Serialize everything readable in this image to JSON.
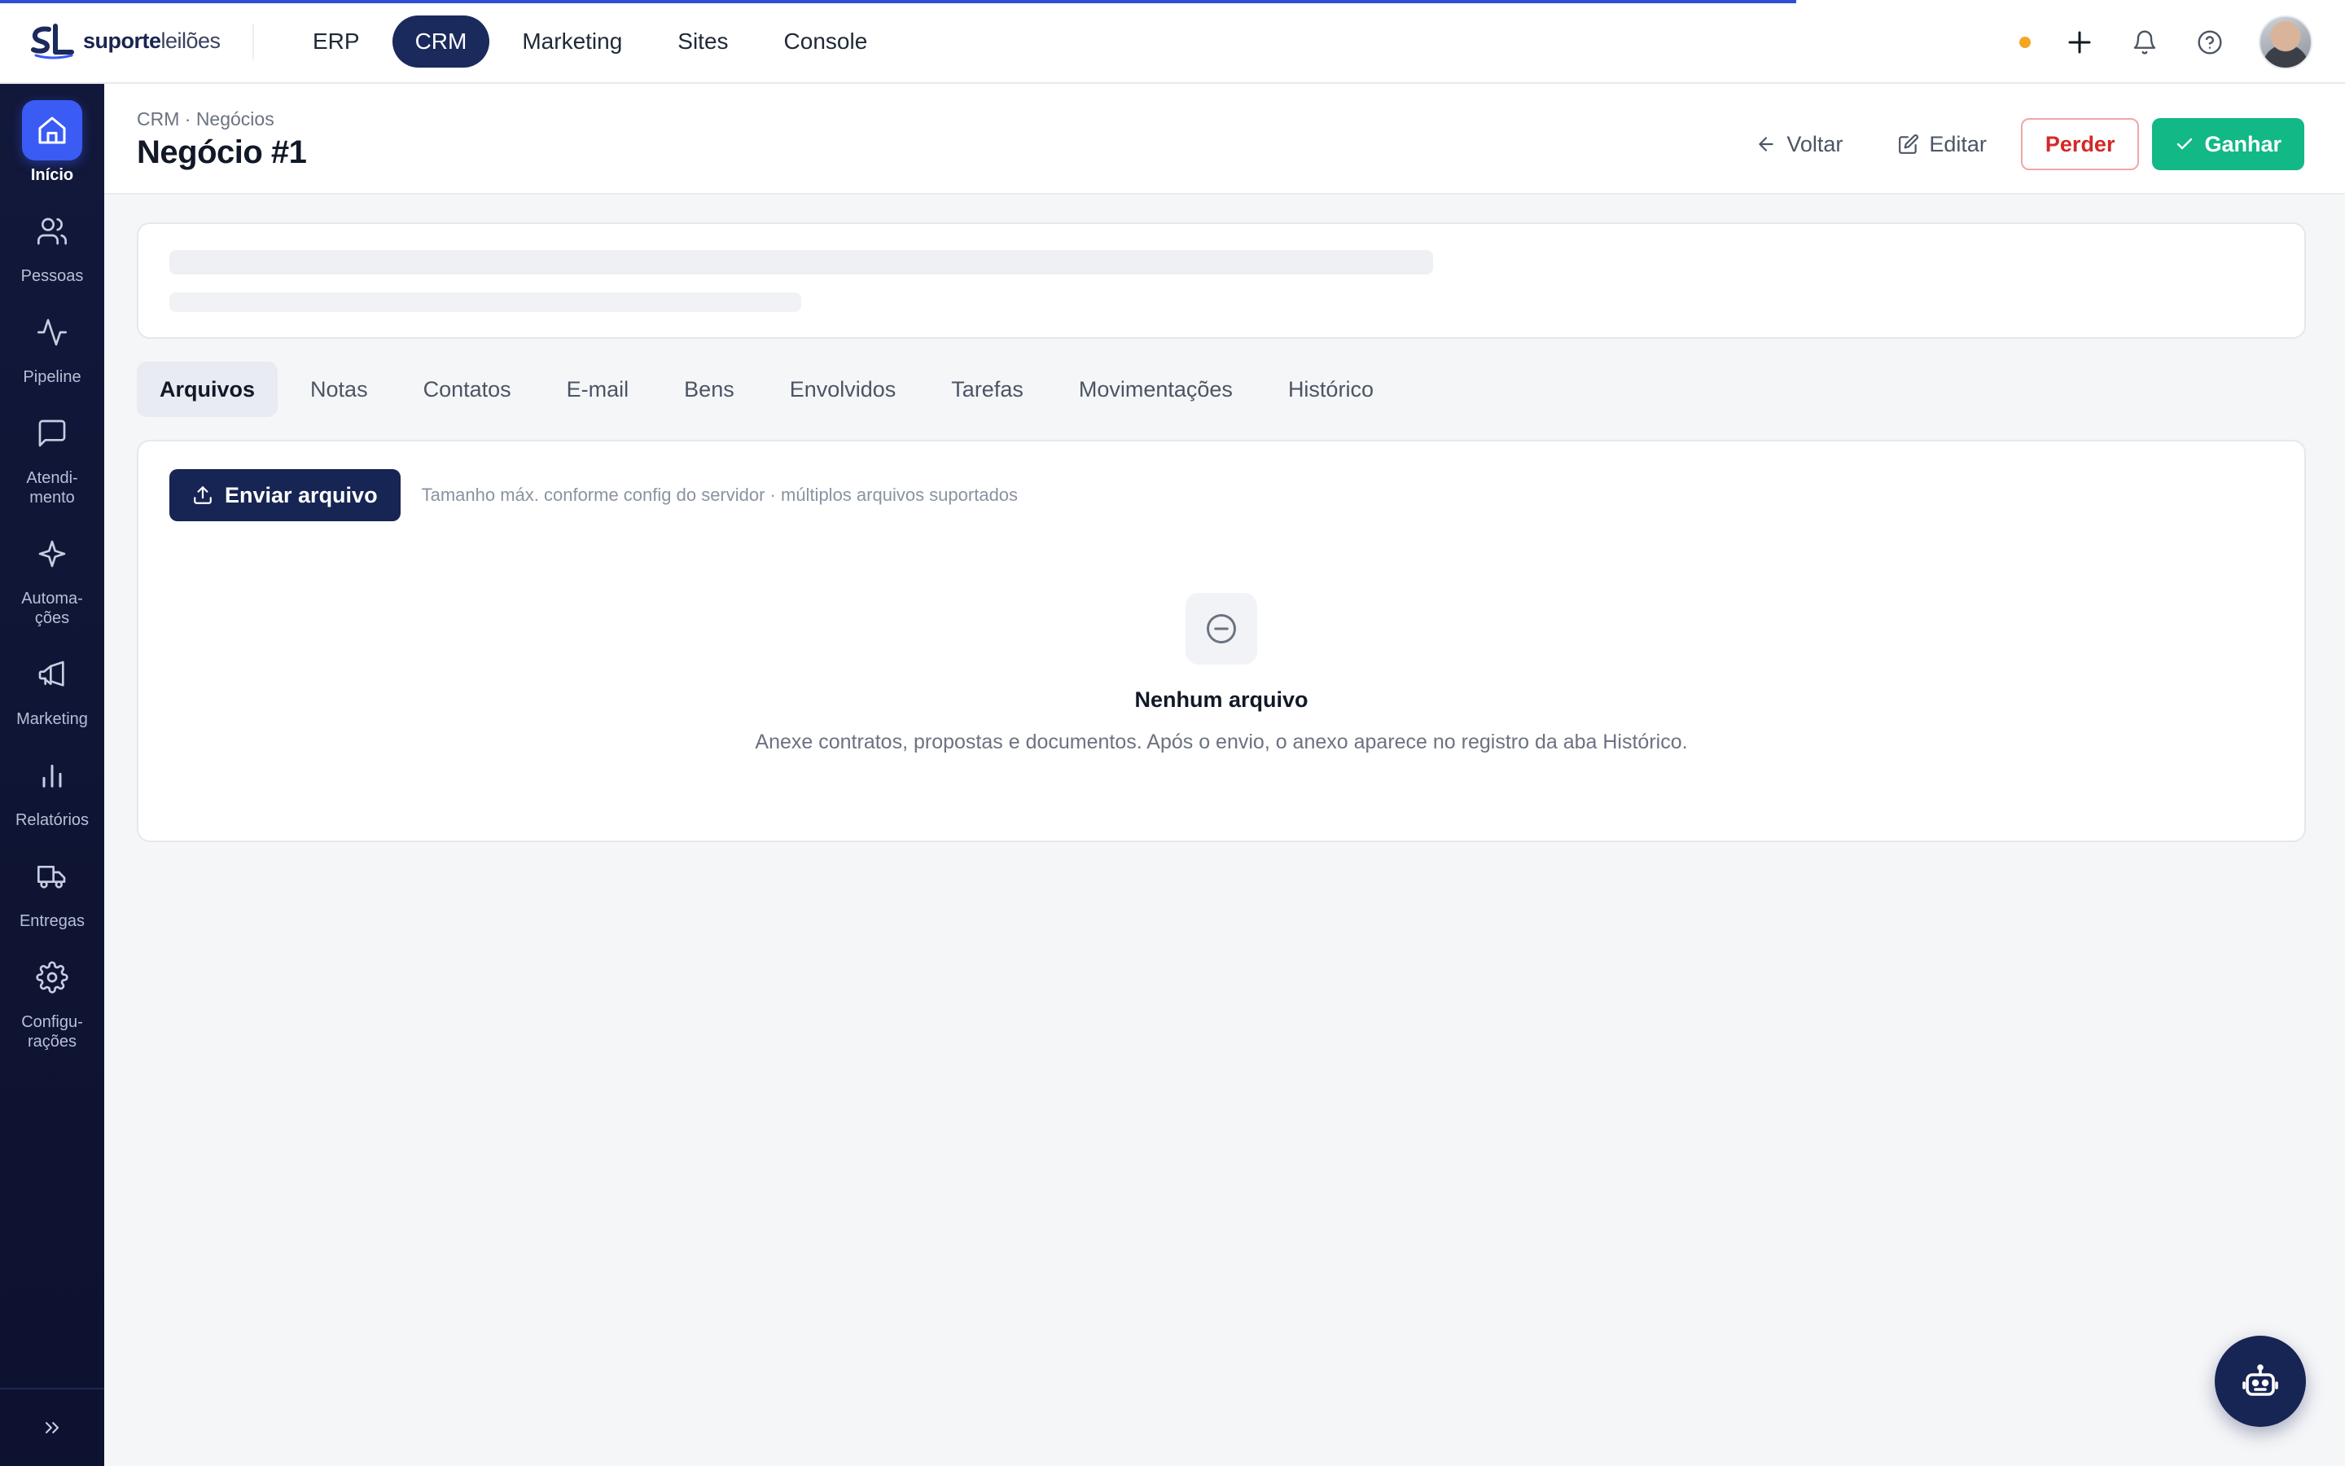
{
  "brand": {
    "bold": "suporte",
    "light": "leilões",
    "logo_icon": "sl-logo-icon"
  },
  "topnav": {
    "items": [
      {
        "label": "ERP",
        "active": false
      },
      {
        "label": "CRM",
        "active": true
      },
      {
        "label": "Marketing",
        "active": false
      },
      {
        "label": "Sites",
        "active": false
      },
      {
        "label": "Console",
        "active": false
      }
    ]
  },
  "top_actions": {
    "status_color": "#f5a524",
    "icons": [
      "plus-icon",
      "bell-icon",
      "help-icon"
    ]
  },
  "sidebar": {
    "items": [
      {
        "label": "Início",
        "icon": "home-icon",
        "active": true
      },
      {
        "label": "Pessoas",
        "icon": "users-icon",
        "active": false
      },
      {
        "label": "Pipeline",
        "icon": "activity-icon",
        "active": false
      },
      {
        "label": "Atendi-\nmento",
        "icon": "chat-icon",
        "active": false
      },
      {
        "label": "Automa-\nções",
        "icon": "sparkle-icon",
        "active": false
      },
      {
        "label": "Marketing",
        "icon": "megaphone-icon",
        "active": false
      },
      {
        "label": "Relatórios",
        "icon": "bar-chart-icon",
        "active": false
      },
      {
        "label": "Entregas",
        "icon": "truck-icon",
        "active": false
      },
      {
        "label": "Configu-\nrações",
        "icon": "gear-icon",
        "active": false
      }
    ]
  },
  "page": {
    "breadcrumb": "CRM · Negócios",
    "title": "Negócio #1",
    "actions": {
      "back": "Voltar",
      "edit": "Editar",
      "lose": "Perder",
      "win": "Ganhar"
    }
  },
  "tabs": [
    {
      "label": "Arquivos",
      "active": true
    },
    {
      "label": "Notas",
      "active": false
    },
    {
      "label": "Contatos",
      "active": false
    },
    {
      "label": "E-mail",
      "active": false
    },
    {
      "label": "Bens",
      "active": false
    },
    {
      "label": "Envolvidos",
      "active": false
    },
    {
      "label": "Tarefas",
      "active": false
    },
    {
      "label": "Movimentações",
      "active": false
    },
    {
      "label": "Histórico",
      "active": false
    }
  ],
  "files": {
    "upload_label": "Enviar arquivo",
    "upload_hint": "Tamanho máx. conforme config do servidor · múltiplos arquivos suportados",
    "empty_title": "Nenhum arquivo",
    "empty_desc": "Anexe contratos, propostas e documentos. Após o envio, o anexo aparece no registro da aba Histórico."
  },
  "colors": {
    "brand_navy": "#172554",
    "accent_blue": "#3b5bf5",
    "success": "#12b886",
    "danger": "#d42828"
  }
}
